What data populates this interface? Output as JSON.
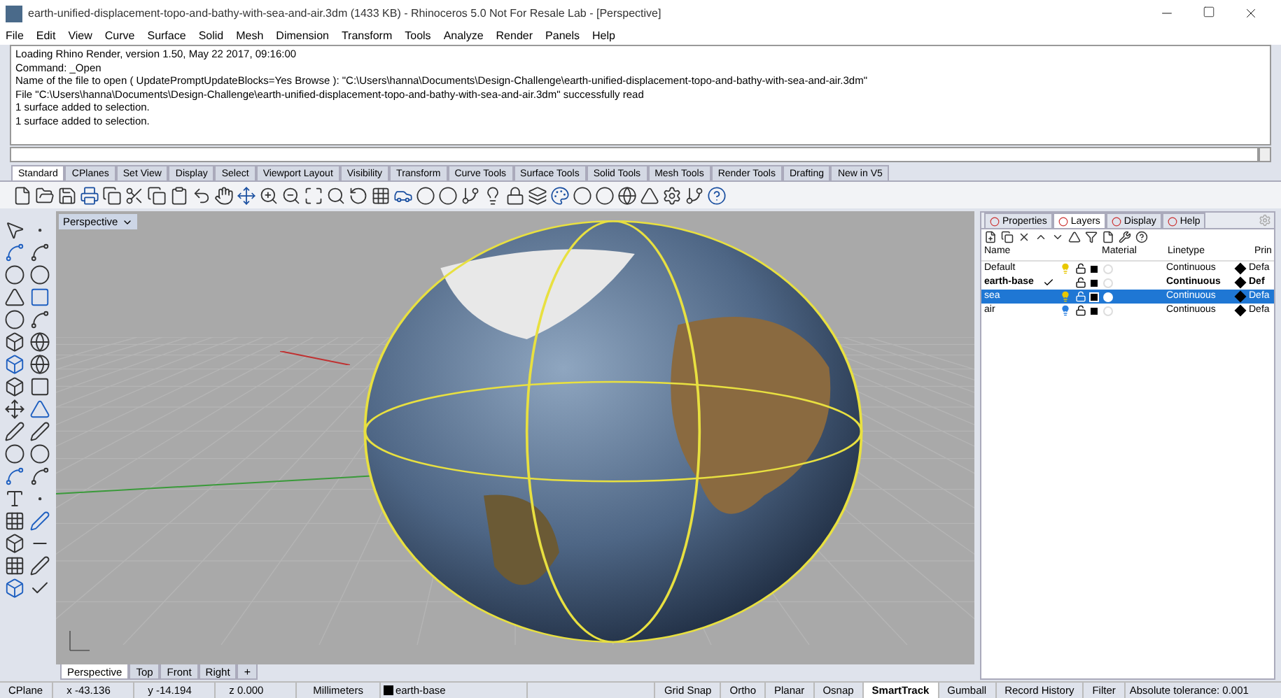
{
  "window": {
    "title": "earth-unified-displacement-topo-and-bathy-with-sea-and-air.3dm (1433 KB) - Rhinoceros 5.0 Not For Resale Lab - [Perspective]"
  },
  "menu": [
    "File",
    "Edit",
    "View",
    "Curve",
    "Surface",
    "Solid",
    "Mesh",
    "Dimension",
    "Transform",
    "Tools",
    "Analyze",
    "Render",
    "Panels",
    "Help"
  ],
  "command_history": [
    "Loading Rhino Render, version 1.50, May 22 2017, 09:16:00",
    "Command: _Open",
    "Name of the file to open ( UpdatePromptUpdateBlocks=Yes  Browse ): \"C:\\Users\\hanna\\Documents\\Design-Challenge\\earth-unified-displacement-topo-and-bathy-with-sea-and-air.3dm\"",
    "File \"C:\\Users\\hanna\\Documents\\Design-Challenge\\earth-unified-displacement-topo-and-bathy-with-sea-and-air.3dm\" successfully read",
    "1 surface added to selection.",
    "1 surface added to selection."
  ],
  "toolbar_tabs": [
    {
      "label": "Standard",
      "selected": true
    },
    {
      "label": "CPlanes",
      "selected": false
    },
    {
      "label": "Set View",
      "selected": false
    },
    {
      "label": "Display",
      "selected": false
    },
    {
      "label": "Select",
      "selected": false
    },
    {
      "label": "Viewport Layout",
      "selected": false
    },
    {
      "label": "Visibility",
      "selected": false
    },
    {
      "label": "Transform",
      "selected": false
    },
    {
      "label": "Curve Tools",
      "selected": false
    },
    {
      "label": "Surface Tools",
      "selected": false
    },
    {
      "label": "Solid Tools",
      "selected": false
    },
    {
      "label": "Mesh Tools",
      "selected": false
    },
    {
      "label": "Render Tools",
      "selected": false
    },
    {
      "label": "Drafting",
      "selected": false
    },
    {
      "label": "New in V5",
      "selected": false
    }
  ],
  "viewport": {
    "title": "Perspective",
    "tabs": [
      {
        "label": "Perspective",
        "selected": true
      },
      {
        "label": "Top",
        "selected": false
      },
      {
        "label": "Front",
        "selected": false
      },
      {
        "label": "Right",
        "selected": false
      }
    ],
    "add_tab": "+"
  },
  "panel": {
    "tabs": [
      {
        "label": "Properties",
        "selected": false
      },
      {
        "label": "Layers",
        "selected": true
      },
      {
        "label": "Display",
        "selected": false
      },
      {
        "label": "Help",
        "selected": false
      }
    ],
    "columns": [
      "Name",
      "Material",
      "Linetype",
      "Prin"
    ],
    "layers": [
      {
        "name": "Default",
        "current": false,
        "selected": false,
        "visible": true,
        "color": "#e8c800",
        "linetype": "Continuous",
        "print": "Defa"
      },
      {
        "name": "earth-base",
        "current": true,
        "selected": false,
        "visible": false,
        "linetype": "Continuous",
        "print": "Def"
      },
      {
        "name": "sea",
        "current": false,
        "selected": true,
        "visible": true,
        "color": "#e8c800",
        "linetype": "Continuous",
        "print": "Defa"
      },
      {
        "name": "air",
        "current": false,
        "selected": false,
        "visible": true,
        "color": "#2a7fe0",
        "linetype": "Continuous",
        "print": "Defa"
      }
    ]
  },
  "status_bar": {
    "cplane": "CPlane",
    "x": "x -43.136",
    "y": "y -14.194",
    "z": "z 0.000",
    "units": "Millimeters",
    "layer": "earth-base",
    "toggles": [
      {
        "label": "Grid Snap",
        "on": false
      },
      {
        "label": "Ortho",
        "on": false
      },
      {
        "label": "Planar",
        "on": false
      },
      {
        "label": "Osnap",
        "on": false
      },
      {
        "label": "SmartTrack",
        "on": true
      },
      {
        "label": "Gumball",
        "on": false
      },
      {
        "label": "Record History",
        "on": false
      },
      {
        "label": "Filter",
        "on": false
      }
    ],
    "tolerance": "Absolute tolerance: 0.001"
  }
}
